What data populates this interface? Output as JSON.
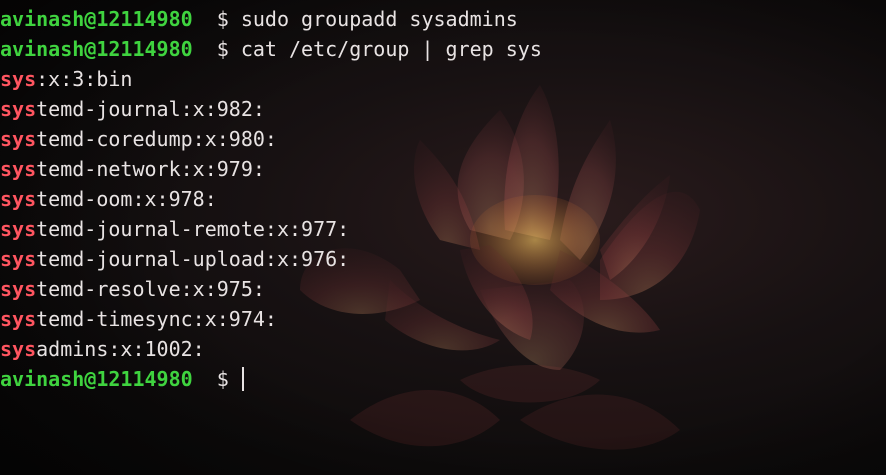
{
  "prompt": {
    "user_host": "avinash@12114980",
    "symbol": "$"
  },
  "history": [
    {
      "type": "command",
      "text": "sudo groupadd sysadmins"
    },
    {
      "type": "command",
      "text": "cat /etc/group | grep sys"
    }
  ],
  "output": [
    {
      "match": "sys",
      "rest": ":x:3:bin"
    },
    {
      "match": "sys",
      "rest": "temd-journal:x:982:"
    },
    {
      "match": "sys",
      "rest": "temd-coredump:x:980:"
    },
    {
      "match": "sys",
      "rest": "temd-network:x:979:"
    },
    {
      "match": "sys",
      "rest": "temd-oom:x:978:"
    },
    {
      "match": "sys",
      "rest": "temd-journal-remote:x:977:"
    },
    {
      "match": "sys",
      "rest": "temd-journal-upload:x:976:"
    },
    {
      "match": "sys",
      "rest": "temd-resolve:x:975:"
    },
    {
      "match": "sys",
      "rest": "temd-timesync:x:974:"
    },
    {
      "match": "sys",
      "rest": "admins:x:1002:"
    }
  ],
  "colors": {
    "prompt_user": "#3fd33f",
    "match_highlight": "#ff5560",
    "text": "#e8e3e3",
    "background": "#0c0b0b"
  },
  "background_image": "lotus-flower"
}
